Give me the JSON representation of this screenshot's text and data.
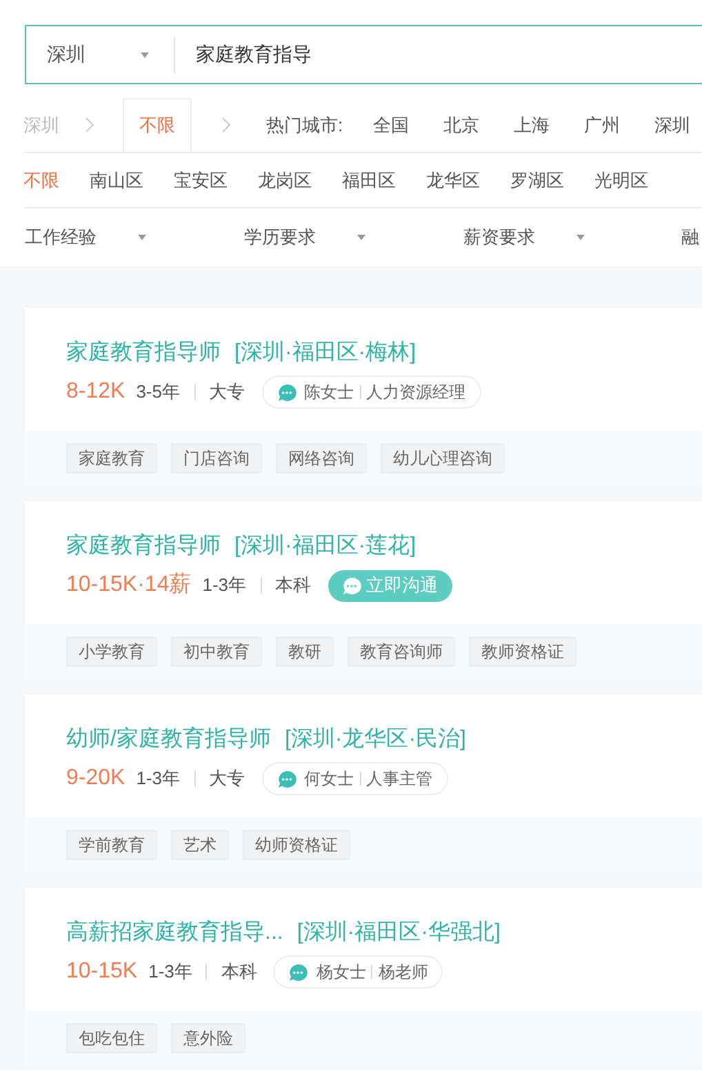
{
  "search": {
    "city": "深圳",
    "query": "家庭教育指导"
  },
  "breadcrumb": {
    "city": "深圳",
    "current": "不限",
    "hot_label": "热门城市:",
    "hot_cities": [
      "全国",
      "北京",
      "上海",
      "广州",
      "深圳"
    ]
  },
  "districts": [
    {
      "label": "不限",
      "selected": true
    },
    {
      "label": "南山区",
      "selected": false
    },
    {
      "label": "宝安区",
      "selected": false
    },
    {
      "label": "龙岗区",
      "selected": false
    },
    {
      "label": "福田区",
      "selected": false
    },
    {
      "label": "龙华区",
      "selected": false
    },
    {
      "label": "罗湖区",
      "selected": false
    },
    {
      "label": "光明区",
      "selected": false
    }
  ],
  "filters": [
    {
      "label": "工作经验",
      "dropdown": true
    },
    {
      "label": "学历要求",
      "dropdown": true
    },
    {
      "label": "薪资要求",
      "dropdown": true
    },
    {
      "label": "融"
    }
  ],
  "jobs": [
    {
      "title": "家庭教育指导师",
      "location": "[深圳·福田区·梅林]",
      "salary": "8-12K",
      "experience": "3-5年",
      "education": "大专",
      "contact": {
        "kind": "recruiter",
        "name": "陈女士",
        "role": "人力资源经理"
      },
      "tags": [
        "家庭教育",
        "门店咨询",
        "网络咨询",
        "幼儿心理咨询"
      ]
    },
    {
      "title": "家庭教育指导师",
      "location": "[深圳·福田区·莲花]",
      "salary": "10-15K·14薪",
      "experience": "1-3年",
      "education": "本科",
      "contact": {
        "kind": "chat_button",
        "label": "立即沟通"
      },
      "tags": [
        "小学教育",
        "初中教育",
        "教研",
        "教育咨询师",
        "教师资格证"
      ]
    },
    {
      "title": "幼师/家庭教育指导师",
      "location": "[深圳·龙华区·民治]",
      "salary": "9-20K",
      "experience": "1-3年",
      "education": "大专",
      "contact": {
        "kind": "recruiter",
        "name": "何女士",
        "role": "人事主管"
      },
      "tags": [
        "学前教育",
        "艺术",
        "幼师资格证"
      ]
    },
    {
      "title": "高薪招家庭教育指导...",
      "location": "[深圳·福田区·华强北]",
      "salary": "10-15K",
      "experience": "1-3年",
      "education": "本科",
      "contact": {
        "kind": "recruiter",
        "name": "杨女士",
        "role": "杨老师"
      },
      "tags": [
        "包吃包住",
        "意外险"
      ]
    }
  ]
}
